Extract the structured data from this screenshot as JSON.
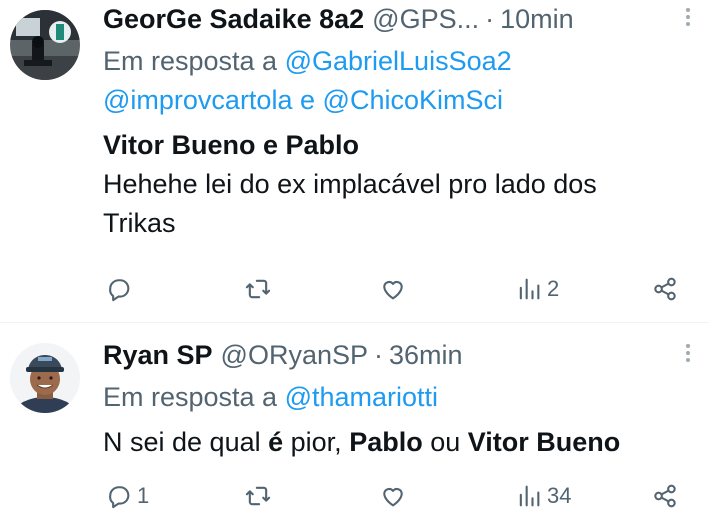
{
  "tweets": [
    {
      "name": "GeorGe Sadaike 8a2",
      "handle": "@GPS...",
      "separator": "·",
      "time": "10min",
      "reply_prefix": "Em resposta a",
      "reply_mention_1": "@GabrielLuisSoa2",
      "reply_mention_2": "@improvcartola",
      "reply_and": "e",
      "reply_mention_3": "@ChicoKimSci",
      "text_bold_line": "Vitor Bueno e Pablo",
      "text_line_2": "Hehehe lei do ex implacável pro lado dos",
      "text_line_3": "Trikas",
      "replies": "",
      "retweets": "",
      "likes": "",
      "views": "2"
    },
    {
      "name": "Ryan SP",
      "handle": "@ORyanSP",
      "separator": "·",
      "time": "36min",
      "reply_prefix": "Em resposta a",
      "reply_mention_1": "@thamariotti",
      "text_part_1": "N sei de qual ",
      "text_bold_1": "é",
      "text_part_2": " pior, ",
      "text_bold_2": "Pablo",
      "text_part_3": " ou ",
      "text_bold_3": "Vitor Bueno",
      "replies": "1",
      "retweets": "",
      "likes": "",
      "views": "34"
    }
  ],
  "icons": {
    "reply": "reply-icon",
    "retweet": "retweet-icon",
    "like": "heart-icon",
    "views": "views-icon",
    "share": "share-icon",
    "more": "more-icon"
  },
  "colors": {
    "text": "#0f1419",
    "muted": "#536471",
    "link": "#1d9bf0",
    "divider": "#eff3f4"
  }
}
